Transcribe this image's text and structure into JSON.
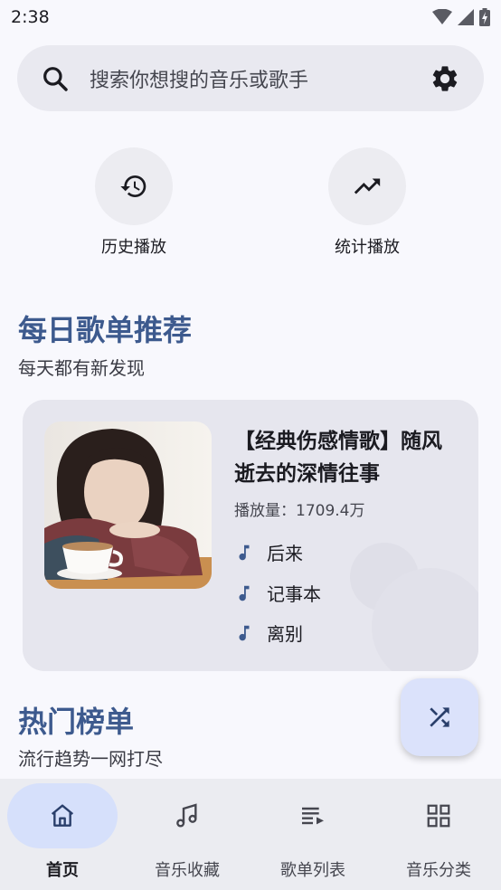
{
  "status_bar": {
    "time": "2:38"
  },
  "search": {
    "placeholder": "搜索你想搜的音乐或歌手",
    "icon": "search-icon",
    "settings_icon": "gear-icon"
  },
  "quick_actions": [
    {
      "label": "历史播放",
      "icon": "history-icon"
    },
    {
      "label": "统计播放",
      "icon": "trending-up-icon"
    }
  ],
  "daily": {
    "title": "每日歌单推荐",
    "subtitle": "每天都有新发现",
    "playlist": {
      "title": "【经典伤感情歌】随风逝去的深情往事",
      "plays": "播放量：1709.4万",
      "songs": [
        "后来",
        "记事本",
        "离别"
      ]
    }
  },
  "hot": {
    "title": "热门榜单",
    "subtitle": "流行趋势一网打尽"
  },
  "fab": {
    "icon": "shuffle-icon"
  },
  "nav": [
    {
      "label": "首页",
      "icon": "home-icon",
      "active": true
    },
    {
      "label": "音乐收藏",
      "icon": "music-note-icon",
      "active": false
    },
    {
      "label": "歌单列表",
      "icon": "playlist-icon",
      "active": false
    },
    {
      "label": "音乐分类",
      "icon": "grid-icon",
      "active": false
    }
  ],
  "colors": {
    "accent": "#3d5a8e",
    "background": "#f8f8fd",
    "card": "#e6e6ee",
    "fab": "#dbe2fb",
    "nav_active": "#d6e0fb"
  }
}
